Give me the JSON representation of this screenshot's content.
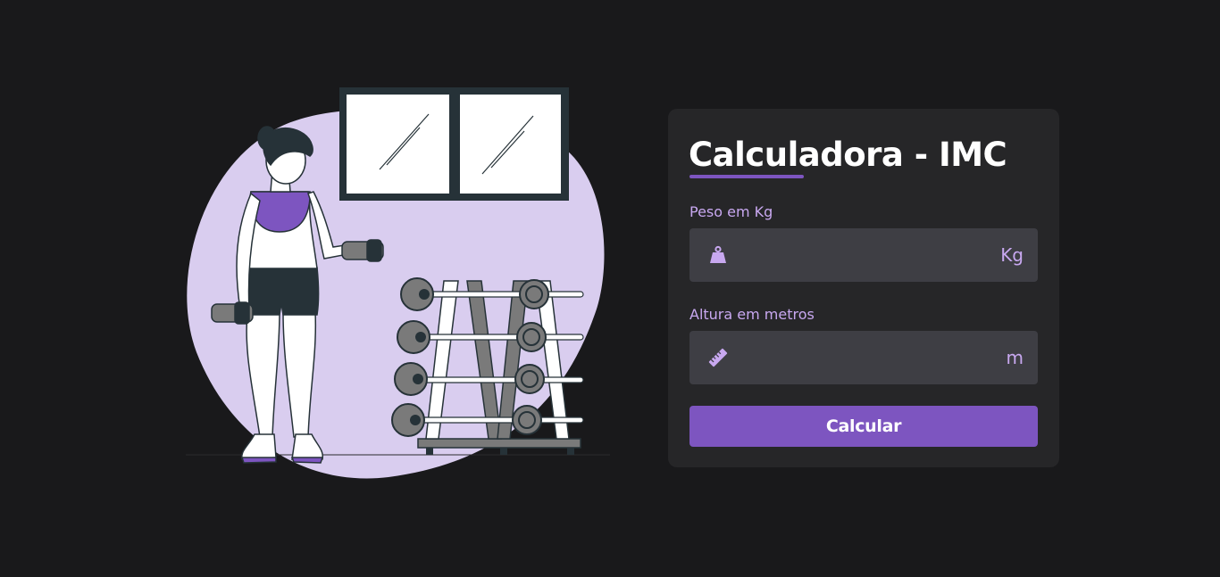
{
  "form": {
    "title": "Calculadora - IMC",
    "weight": {
      "label": "Peso em Kg",
      "value": "",
      "unit": "Kg",
      "icon": "weight-icon"
    },
    "height": {
      "label": "Altura em metros",
      "value": "",
      "unit": "m",
      "icon": "ruler-icon"
    },
    "submit_label": "Calcular"
  },
  "colors": {
    "background": "#19191b",
    "card": "#262628",
    "input": "#3e3e44",
    "accent": "#7d55c0",
    "label": "#c8a8f0",
    "blob": "#d9cdef"
  }
}
